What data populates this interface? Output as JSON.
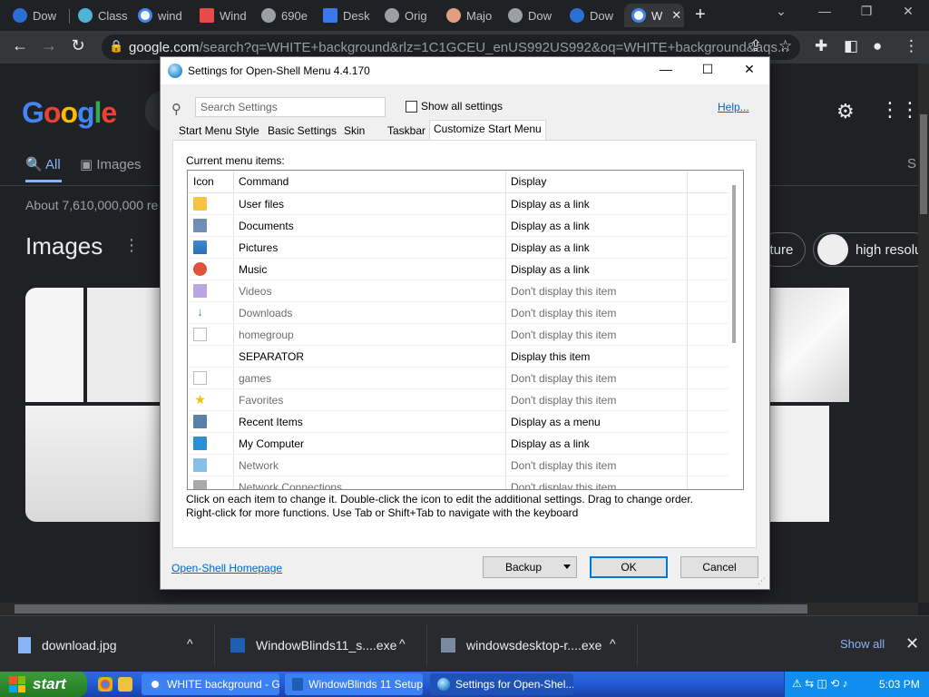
{
  "browser": {
    "tabs": [
      {
        "label": "Dow",
        "color": "#2b6fd6"
      },
      {
        "label": "Class",
        "color": "#4fb3d6"
      },
      {
        "label": "wind",
        "color": "#ffffff"
      },
      {
        "label": "Wind",
        "color": "#e84a4a"
      },
      {
        "label": "690e",
        "color": "#9aa0a6"
      },
      {
        "label": "Desk",
        "color": "#3b78e7"
      },
      {
        "label": "Orig",
        "color": "#9aa0a6"
      },
      {
        "label": "Majo",
        "color": "#e0a080"
      },
      {
        "label": "Dow",
        "color": "#9aa0a6"
      },
      {
        "label": "Dow",
        "color": "#2b6fd6"
      },
      {
        "label": "W",
        "color": "#ffffff"
      }
    ],
    "url_host": "google.com",
    "url_path": "/search?q=WHITE+background&rlz=1C1GCEU_enUS992US992&oq=WHITE+background&aqs..."
  },
  "google": {
    "nav_all": "All",
    "nav_images": "Images",
    "about": "About 7,610,000,000 re",
    "images_heading": "Images",
    "chip_texture": "xture",
    "chip_high": "high resolu",
    "s_letter": "S"
  },
  "downloads": {
    "items": [
      {
        "name": "download.jpg"
      },
      {
        "name": "WindowBlinds11_s....exe"
      },
      {
        "name": "windowsdesktop-r....exe"
      }
    ],
    "show_all": "Show all"
  },
  "taskbar": {
    "start": "start",
    "buttons": [
      {
        "label": "WHITE background - G..."
      },
      {
        "label": "WindowBlinds 11 Setup"
      },
      {
        "label": "Settings for Open-Shel..."
      }
    ],
    "clock": "5:03 PM"
  },
  "dialog": {
    "title": "Settings for Open-Shell Menu 4.4.170",
    "search_placeholder": "Search Settings",
    "show_all": "Show all settings",
    "help": "Help...",
    "tabs": [
      "Start Menu Style",
      "Basic Settings",
      "Skin",
      "Taskbar",
      "Customize Start Menu"
    ],
    "current_label": "Current menu items:",
    "columns": {
      "icon": "Icon",
      "command": "Command",
      "display": "Display"
    },
    "items": [
      {
        "command": "User files",
        "display": "Display as a link",
        "dim": false,
        "icon": "folder-icon"
      },
      {
        "command": "Documents",
        "display": "Display as a link",
        "dim": false,
        "icon": "documents-icon"
      },
      {
        "command": "Pictures",
        "display": "Display as a link",
        "dim": false,
        "icon": "pictures-icon"
      },
      {
        "command": "Music",
        "display": "Display as a link",
        "dim": false,
        "icon": "music-icon"
      },
      {
        "command": "Videos",
        "display": "Don't display this item",
        "dim": true,
        "icon": "videos-icon"
      },
      {
        "command": "Downloads",
        "display": "Don't display this item",
        "dim": true,
        "icon": "downloads-icon"
      },
      {
        "command": "homegroup",
        "display": "Don't display this item",
        "dim": true,
        "icon": "blank-page-icon"
      },
      {
        "command": "SEPARATOR",
        "display": "Display this item",
        "dim": false,
        "icon": ""
      },
      {
        "command": "games",
        "display": "Don't display this item",
        "dim": true,
        "icon": "blank-page-icon"
      },
      {
        "command": "Favorites",
        "display": "Don't display this item",
        "dim": true,
        "icon": "star-icon"
      },
      {
        "command": "Recent Items",
        "display": "Display as a menu",
        "dim": false,
        "icon": "recent-items-icon"
      },
      {
        "command": "My Computer",
        "display": "Display as a link",
        "dim": false,
        "icon": "computer-icon"
      },
      {
        "command": "Network",
        "display": "Don't display this item",
        "dim": true,
        "icon": "network-icon"
      },
      {
        "command": "Network Connections",
        "display": "Don't display this item",
        "dim": true,
        "icon": "network-connections-icon"
      }
    ],
    "help_line1": "Click on each item to change it. Double-click the icon to edit the additional settings. Drag to change order.",
    "help_line2": "Right-click for more functions. Use Tab or Shift+Tab to navigate with the keyboard",
    "homepage": "Open-Shell Homepage",
    "backup": "Backup",
    "ok": "OK",
    "cancel": "Cancel"
  }
}
